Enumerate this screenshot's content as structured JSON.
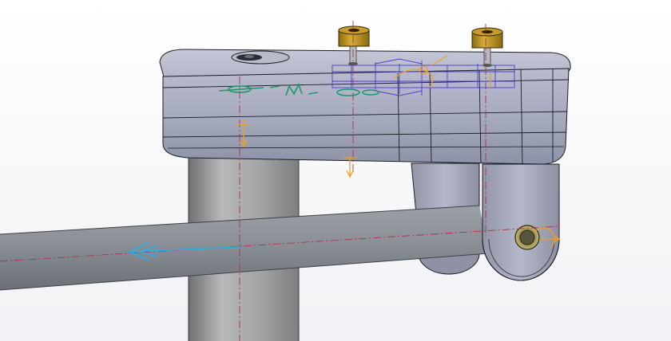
{
  "viewport": {
    "background_top": "#ffffff",
    "background_bottom": "#f2f2f6"
  },
  "scene": {
    "part_body_color": "#a9adbf",
    "rod_color": "#8b9196",
    "column_color": "#9c9ea0",
    "edge_color": "#1b1d26",
    "screw_color": "#b99020",
    "axis_line_color": "#b03050",
    "constraint_color": "#f0a020",
    "annotation_color": "#1a9a6c",
    "sketch_color": "#4a3cd0",
    "direction_arrow_color": "#2ab0e8"
  }
}
